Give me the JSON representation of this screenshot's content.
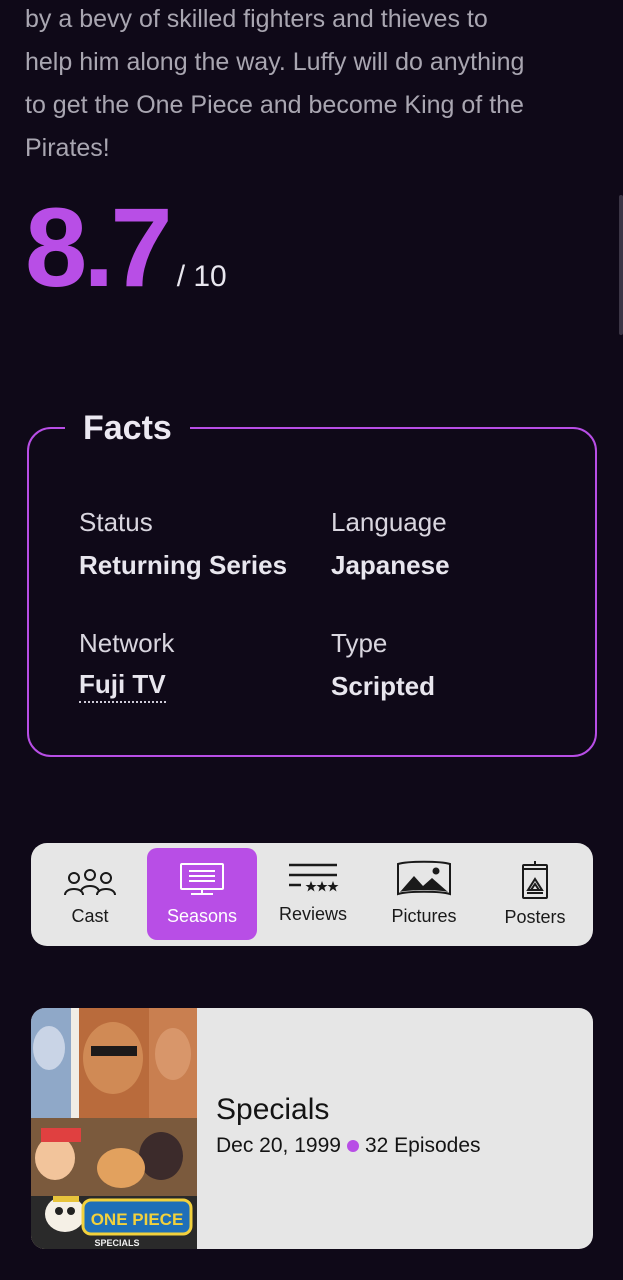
{
  "overview": {
    "line1": "by a bevy of skilled fighters and thieves to",
    "line2": "help him along the way. Luffy will do anything",
    "line3": "to get the One Piece and become King of the",
    "line4": "Pirates!"
  },
  "rating": {
    "value": "8.7",
    "max": "/ 10"
  },
  "facts": {
    "title": "Facts",
    "status_label": "Status",
    "status_value": "Returning Series",
    "language_label": "Language",
    "language_value": "Japanese",
    "network_label": "Network",
    "network_value": "Fuji TV",
    "type_label": "Type",
    "type_value": "Scripted"
  },
  "tabs": [
    {
      "label": "Cast",
      "icon": "people-icon",
      "active": false
    },
    {
      "label": "Seasons",
      "icon": "tv-list-icon",
      "active": true
    },
    {
      "label": "Reviews",
      "icon": "reviews-stars-icon",
      "active": false
    },
    {
      "label": "Pictures",
      "icon": "landscape-picture-icon",
      "active": false
    },
    {
      "label": "Posters",
      "icon": "poster-icon",
      "active": false
    }
  ],
  "season": {
    "name": "Specials",
    "date": "Dec 20, 1999",
    "episodes": "32 Episodes",
    "poster_logo_text": "ONE PIECE",
    "poster_caption": "SPECIALS"
  },
  "colors": {
    "background": "#0f0918",
    "accent": "#b84ee6",
    "card": "#e6e6e6"
  }
}
